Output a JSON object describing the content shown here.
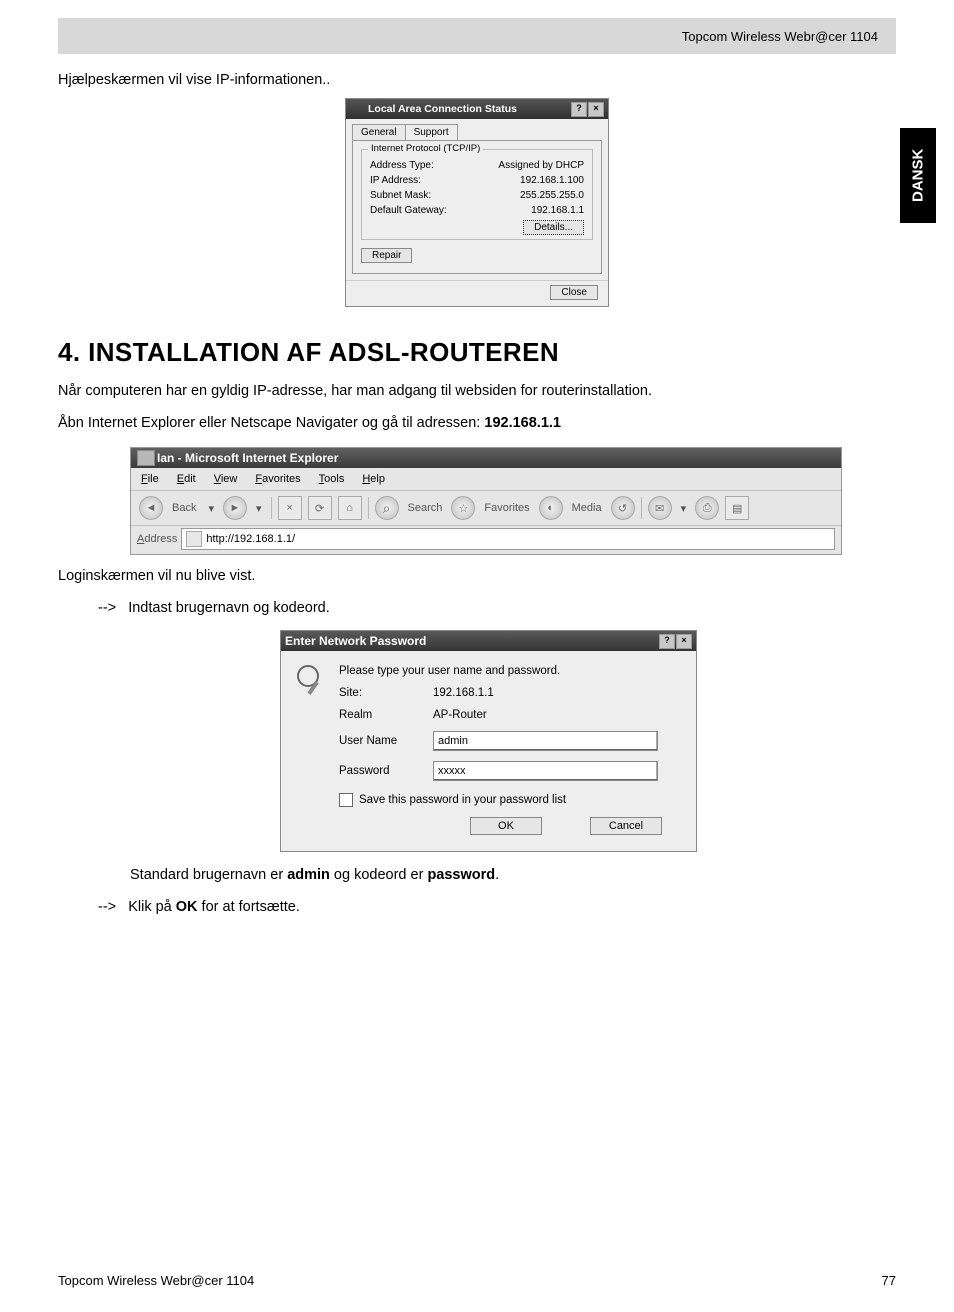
{
  "page": {
    "header_product": "Topcom Wireless Webr@cer 1104",
    "side_tab": "DANSK",
    "footer_left": "Topcom Wireless Webr@cer 1104",
    "footer_right": "77"
  },
  "text": {
    "intro_line": "Hjælpeskærmen vil vise IP-informationen..",
    "section_heading": "4. INSTALLATION AF ADSL-ROUTEREN",
    "para1": "Når computeren har en gyldig IP-adresse, har man adgang til websiden for routerinstallation.",
    "para2a": "Åbn Internet Explorer eller Netscape Navigater og gå til adressen: ",
    "para2b": "192.168.1.1",
    "para3": "Loginskærmen vil nu blive vist.",
    "bullet1_arrow": "-->",
    "bullet1": "Indtast brugernavn og kodeord.",
    "para4a": "Standard brugernavn er ",
    "para4b": "admin",
    "para4c": " og kodeord er ",
    "para4d": "password",
    "para4e": ".",
    "bullet2_arrow": "-->",
    "bullet2a": "Klik på ",
    "bullet2b": "OK",
    "bullet2c": " for at fortsætte."
  },
  "status_dialog": {
    "title": "Local Area Connection Status",
    "help_btn": "?",
    "close_btn": "×",
    "tab_general": "General",
    "tab_support": "Support",
    "group_label": "Internet Protocol (TCP/IP)",
    "rows": [
      {
        "k": "Address Type:",
        "v": "Assigned by DHCP"
      },
      {
        "k": "IP Address:",
        "v": "192.168.1.100"
      },
      {
        "k": "Subnet Mask:",
        "v": "255.255.255.0"
      },
      {
        "k": "Default Gateway:",
        "v": "192.168.1.1"
      }
    ],
    "details_btn": "Details...",
    "repair_btn": "Repair",
    "close_btn_label": "Close"
  },
  "browser": {
    "title": "Ian - Microsoft Internet Explorer",
    "menu": {
      "file": "File",
      "edit": "Edit",
      "view": "View",
      "favs": "Favorites",
      "tools": "Tools",
      "help": "Help"
    },
    "back": "Back",
    "search": "Search",
    "favorites": "Favorites",
    "media": "Media",
    "address_label": "Address",
    "address_value": "http://192.168.1.1/"
  },
  "password_dialog": {
    "title": "Enter Network Password",
    "help_btn": "?",
    "close_btn": "×",
    "prompt": "Please type your user name and password.",
    "site_label": "Site:",
    "site_value": "192.168.1.1",
    "realm_label": "Realm",
    "realm_value": "AP-Router",
    "user_label": "User Name",
    "user_value": "admin",
    "pass_label": "Password",
    "pass_value": "xxxxx",
    "save_label": "Save this password in your password list",
    "ok": "OK",
    "cancel": "Cancel"
  }
}
